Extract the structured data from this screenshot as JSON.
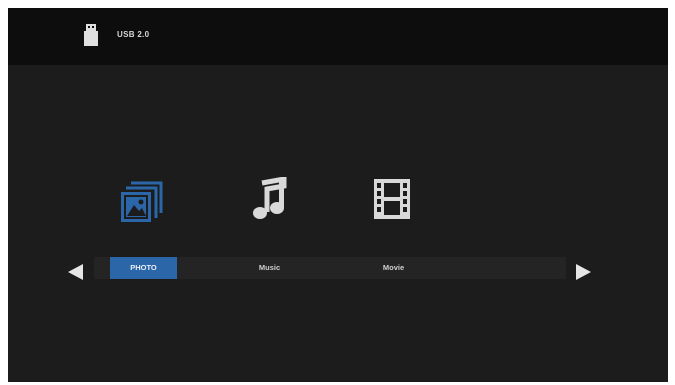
{
  "header": {
    "device_label": "USB 2.0",
    "device_icon": "usb-drive-icon"
  },
  "media": {
    "items": [
      {
        "label": "PHOTO",
        "icon": "photo-icon",
        "selected": true
      },
      {
        "label": "Music",
        "icon": "music-note-icon",
        "selected": false
      },
      {
        "label": "Movie",
        "icon": "film-icon",
        "selected": false
      }
    ]
  },
  "navigation": {
    "prev_icon": "arrow-left-icon",
    "next_icon": "arrow-right-icon"
  },
  "colors": {
    "background": "#1c1c1c",
    "topbar": "#0d0d0d",
    "accent": "#2a66a8",
    "icon_inactive": "#d9d9d9"
  }
}
